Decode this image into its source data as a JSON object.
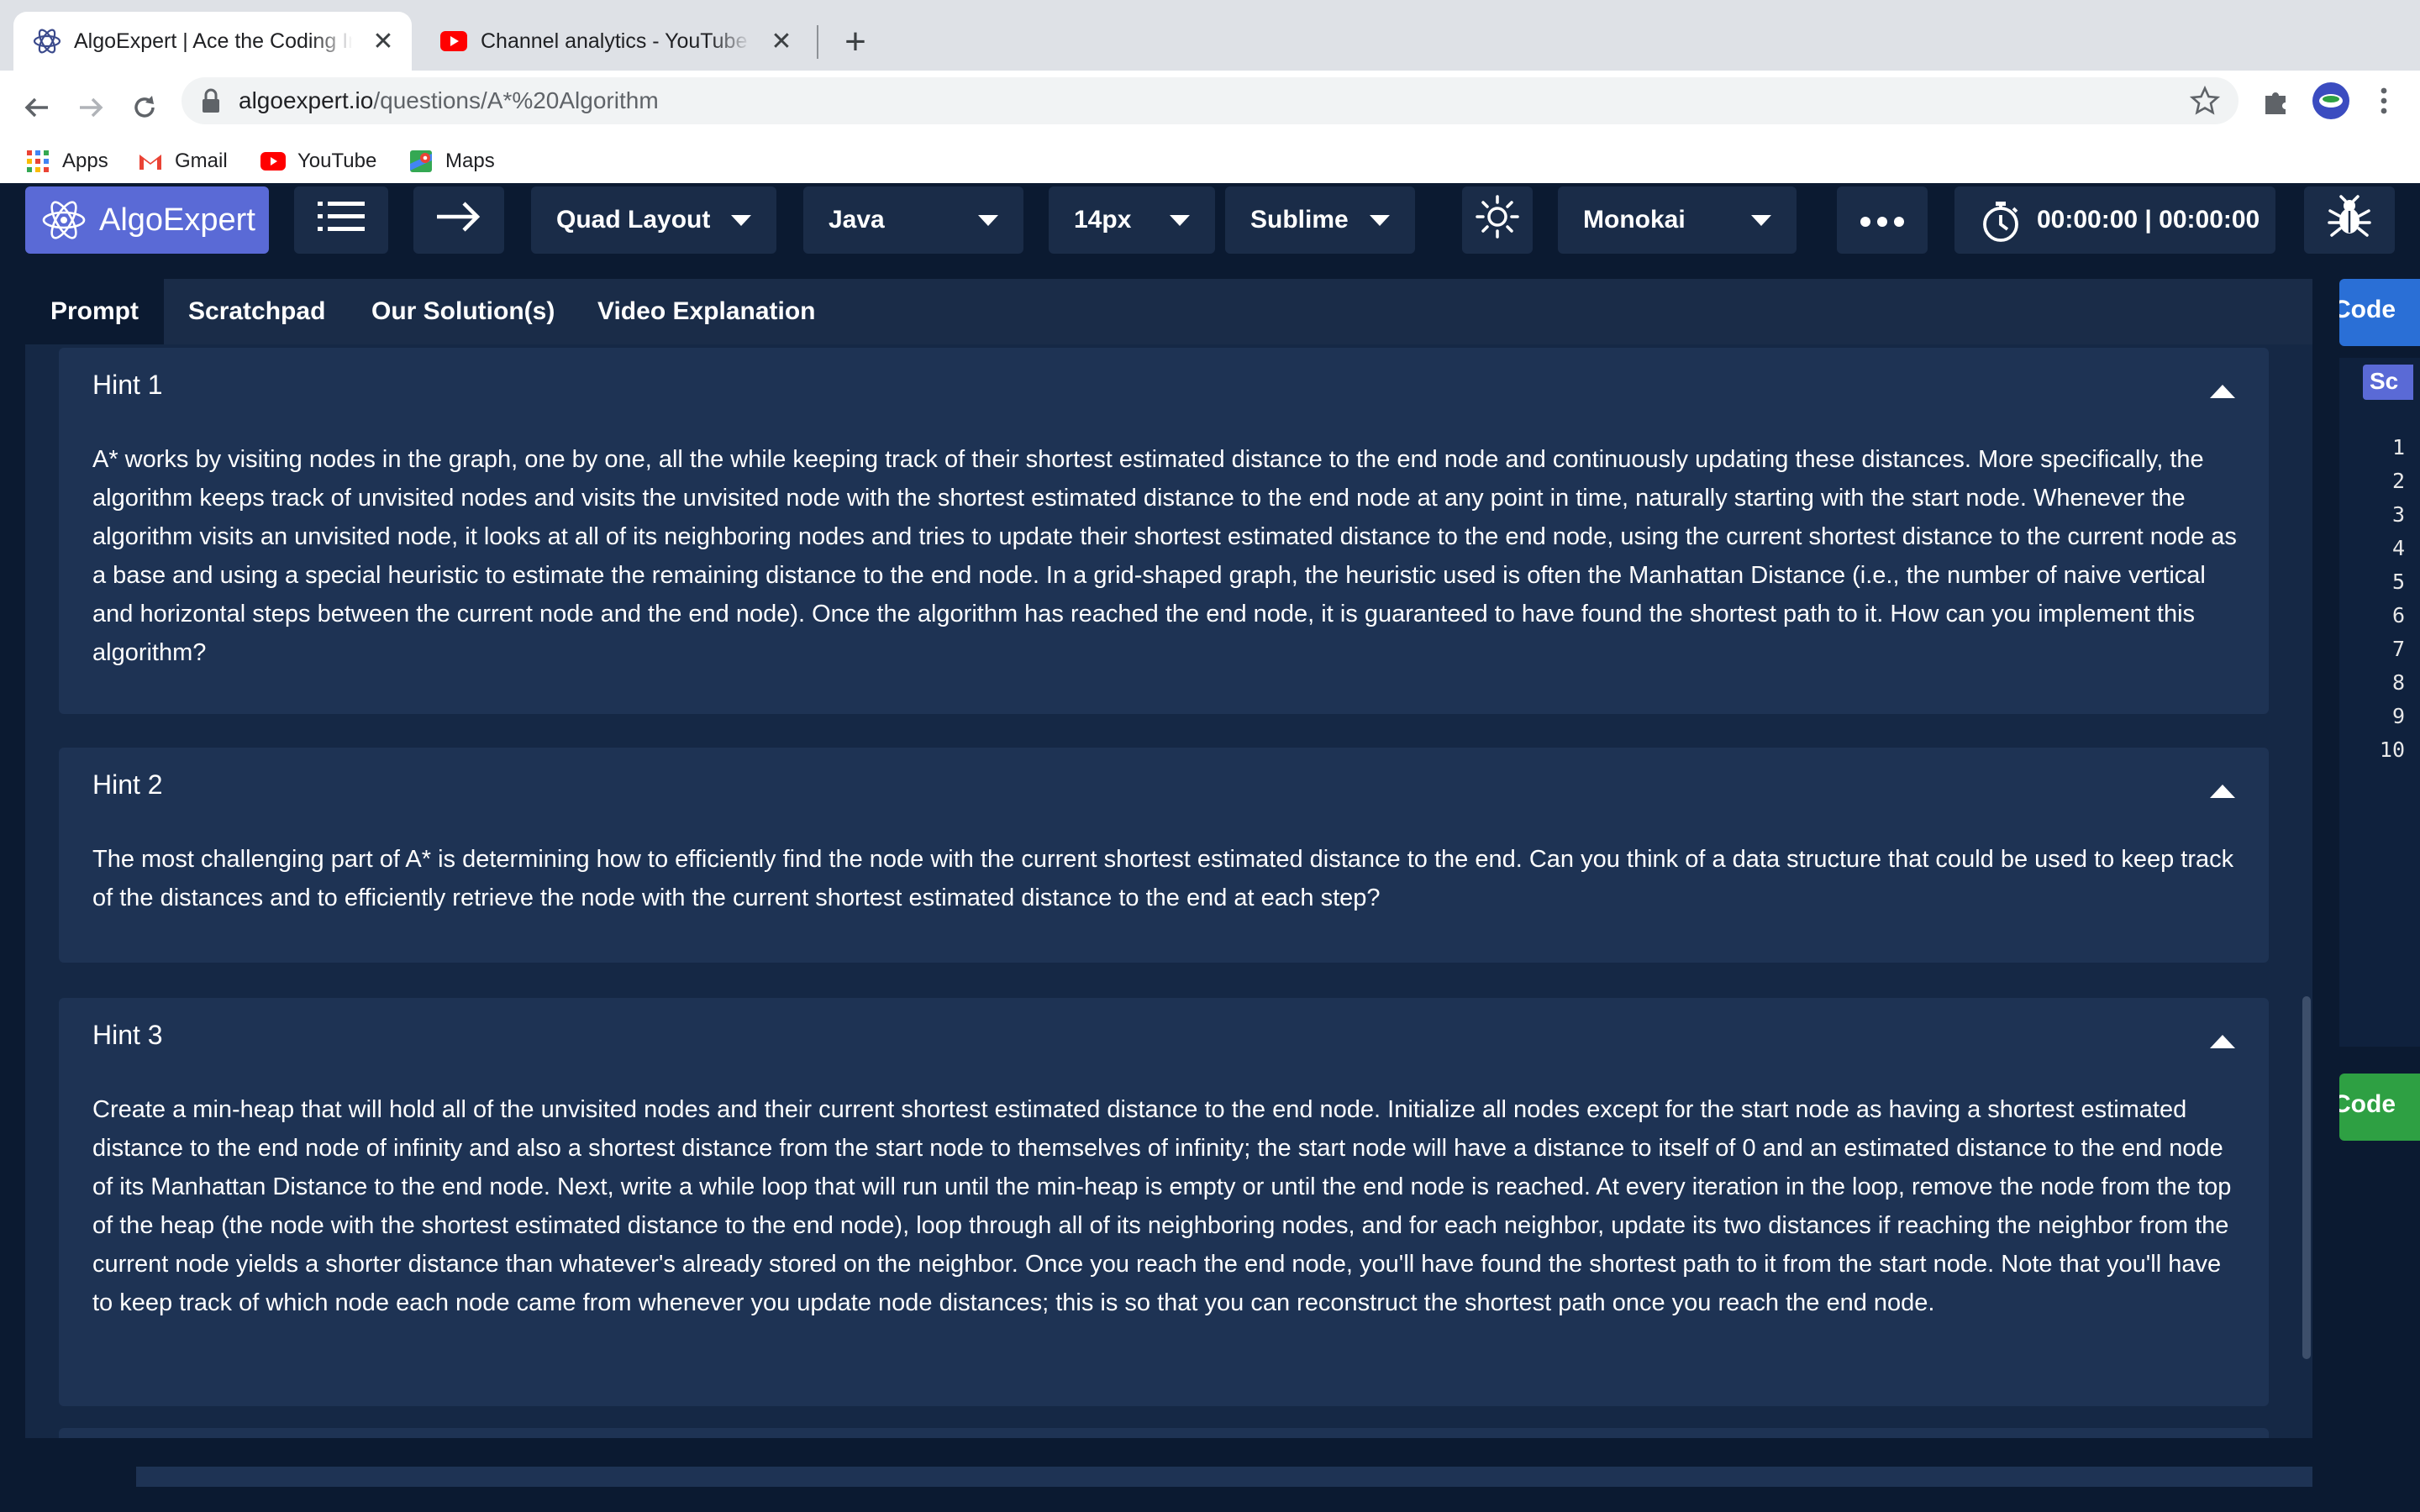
{
  "browser": {
    "tabs": [
      {
        "title": "AlgoExpert | Ace the Coding Interviews",
        "active": true,
        "favicon": "algoexpert-icon"
      },
      {
        "title": "Channel analytics - YouTube Studio",
        "active": false,
        "favicon": "youtube-icon"
      }
    ],
    "url_host": "algoexpert.io",
    "url_path": "/questions/A*%20Algorithm",
    "bookmarks": [
      {
        "label": "Apps",
        "icon": "apps-grid-icon"
      },
      {
        "label": "Gmail",
        "icon": "gmail-icon"
      },
      {
        "label": "YouTube",
        "icon": "youtube-icon"
      },
      {
        "label": "Maps",
        "icon": "maps-icon"
      }
    ]
  },
  "appbar": {
    "logo": "AlgoExpert",
    "layout": "Quad Layout",
    "language": "Java",
    "font_size": "14px",
    "keymap": "Sublime",
    "theme": "Monokai",
    "timer": "00:00:00 | 00:00:00"
  },
  "panel": {
    "tabs": [
      "Prompt",
      "Scratchpad",
      "Our Solution(s)",
      "Video Explanation"
    ],
    "active_tab": "Prompt",
    "hints": [
      {
        "title": "Hint 1",
        "body": "A* works by visiting nodes in the graph, one by one, all the while keeping track of their shortest estimated distance to the end node and continuously updating these distances. More specifically, the algorithm keeps track of unvisited nodes and visits the unvisited node with the shortest estimated distance to the end node at any point in time, naturally starting with the start node. Whenever the algorithm visits an unvisited node, it looks at all of its neighboring nodes and tries to update their shortest estimated distance to the end node, using the current shortest distance to the current node as a base and using a special heuristic to estimate the remaining distance to the end node. In a grid-shaped graph, the heuristic used is often the Manhattan Distance (i.e., the number of naive vertical and horizontal steps between the current node and the end node). Once the algorithm has reached the end node, it is guaranteed to have found the shortest path to it. How can you implement this algorithm?"
      },
      {
        "title": "Hint 2",
        "body": "The most challenging part of A* is determining how to efficiently find the node with the current shortest estimated distance to the end. Can you think of a data structure that could be used to keep track of the distances and to efficiently retrieve the node with the current shortest estimated distance to the end at each step?"
      },
      {
        "title": "Hint 3",
        "body": "Create a min-heap that will hold all of the unvisited nodes and their current shortest estimated distance to the end node. Initialize all nodes except for the start node as having a shortest estimated distance to the end node of infinity and also a shortest distance from the start node to themselves of infinity; the start node will have a distance to itself of 0 and an estimated distance to the end node of its Manhattan Distance to the end node. Next, write a while loop that will run until the min-heap is empty or until the end node is reached. At every iteration in the loop, remove the node from the top of the heap (the node with the shortest estimated distance to the end node), loop through all of its neighboring nodes, and for each neighbor, update its two distances if reaching the neighbor from the current node yields a shorter distance than whatever's already stored on the neighbor. Once you reach the end node, you'll have found the shortest path to it from the start node. Note that you'll have to keep track of which node each node came from whenever you update node distances; this is so that you can reconstruct the shortest path once you reach the end node."
      }
    ]
  },
  "right_panel": {
    "code_tab_partial": "Code",
    "sc_partial": "Sc",
    "run_button_partial": "Code",
    "line_numbers": [
      "1",
      "2",
      "3",
      "4",
      "5",
      "6",
      "7",
      "8",
      "9",
      "10"
    ]
  },
  "colors": {
    "app_bg": "#0b1a31",
    "button_bg": "#1a2c48",
    "accent": "#5a6ad6",
    "hint_bg": "#1e3354",
    "blue_tab": "#2a6fd6",
    "green_button": "#2ea043"
  }
}
